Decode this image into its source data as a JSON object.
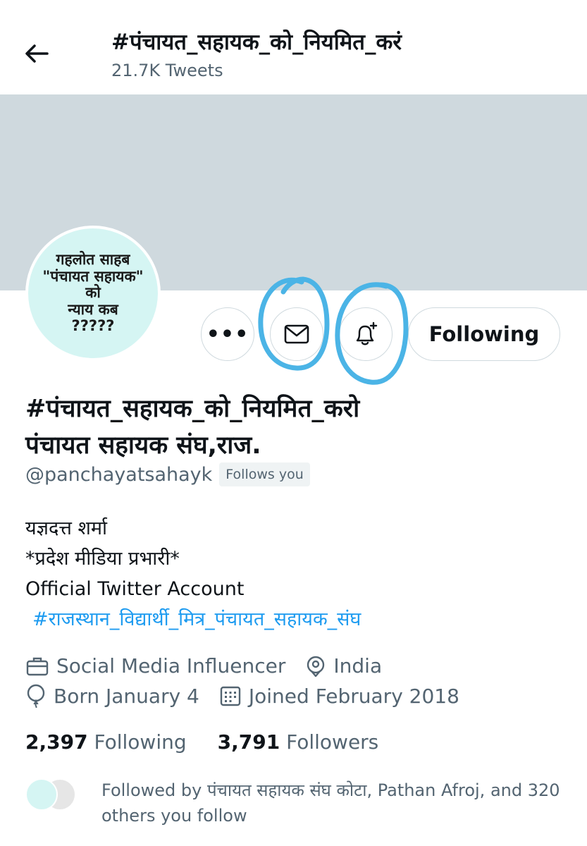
{
  "header": {
    "title": "#पंचायत_सहायक_को_नियमित_करं",
    "tweet_count": "21.7K Tweets"
  },
  "avatar": {
    "lines": [
      "गहलोत साहब",
      "\"पंचायत सहायक\"",
      "को",
      "न्याय कब",
      "?????"
    ]
  },
  "actions": {
    "more_label": "•••",
    "following_label": "Following"
  },
  "profile": {
    "name_line1": "#पंचायत_सहायक_को_नियमित_करो",
    "name_line2": "पंचायत सहायक संघ,राज.",
    "handle": "@panchayatsahayk",
    "follows_you": "Follows you",
    "bio": [
      "यज्ञदत्त शर्मा",
      "*प्रदेश मीडिया प्रभारी*",
      "Official Twitter Account"
    ],
    "bio_hashtag": "#राजस्थान_विद्यार्थी_मित्र_पंचायत_सहायक_संघ",
    "category": "Social Media Influencer",
    "location": "India",
    "birthday": "Born January 4",
    "joined": "Joined February 2018"
  },
  "stats": {
    "following_count": "2,397",
    "following_label": "Following",
    "followers_count": "3,791",
    "followers_label": "Followers"
  },
  "followed_by": {
    "text": "Followed by पंचायत सहायक संघ कोटा, Pathan Afroj, and 320 others you follow"
  },
  "colors": {
    "accent": "#1d9bf0",
    "annotation": "#4bb4e6",
    "banner": "#cfd9de",
    "secondary_text": "#536471"
  },
  "icons": [
    "back-arrow-icon",
    "more-icon",
    "mail-icon",
    "bell-plus-icon",
    "briefcase-icon",
    "location-pin-icon",
    "balloon-icon",
    "calendar-icon"
  ]
}
